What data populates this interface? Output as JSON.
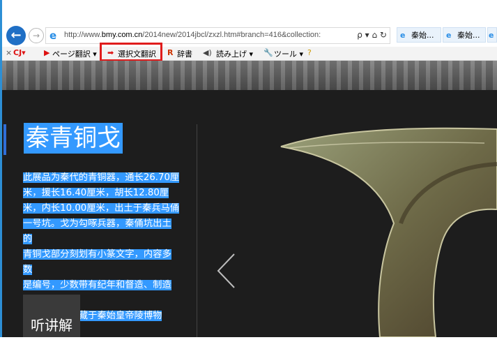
{
  "browser": {
    "url_prefix": "http://www.",
    "url_domain": "bmy.com.cn",
    "url_rest": "/2014new/2014jbcl/zxzl.htm#branch=416&collection:",
    "address_tools": "ρ ▾ ⌂ ↻",
    "tabs": [
      "秦始...",
      "秦始..."
    ]
  },
  "toolbar": {
    "close": "×",
    "cj": "CJ▾",
    "page_translate": "ページ翻訳 ▾",
    "selected_translate": "選択文翻訳",
    "dictionary": "辞書",
    "read_aloud": "読み上げ ▾",
    "tools": "ツール ▾"
  },
  "page": {
    "title": "秦青铜戈",
    "description_lines": [
      "此展品为秦代的青铜器，通长26.70厘",
      "米，援长16.40厘米，胡长12.80厘",
      "米，内长10.00厘米，出土于秦兵马俑",
      "一号坑。戈为勾啄兵器，秦俑坑出土的",
      "青铜戈部分刻划有小篆文字，内容多数",
      "是编号，少数带有纪年和督造、制造者",
      "等铭文。现收藏于秦始皇帝陵博物院。"
    ],
    "listen_label": "听讲解"
  },
  "colors": {
    "highlight": "#3399ff",
    "annotation_box": "#e01c1c",
    "accent": "#2f6fd8"
  }
}
